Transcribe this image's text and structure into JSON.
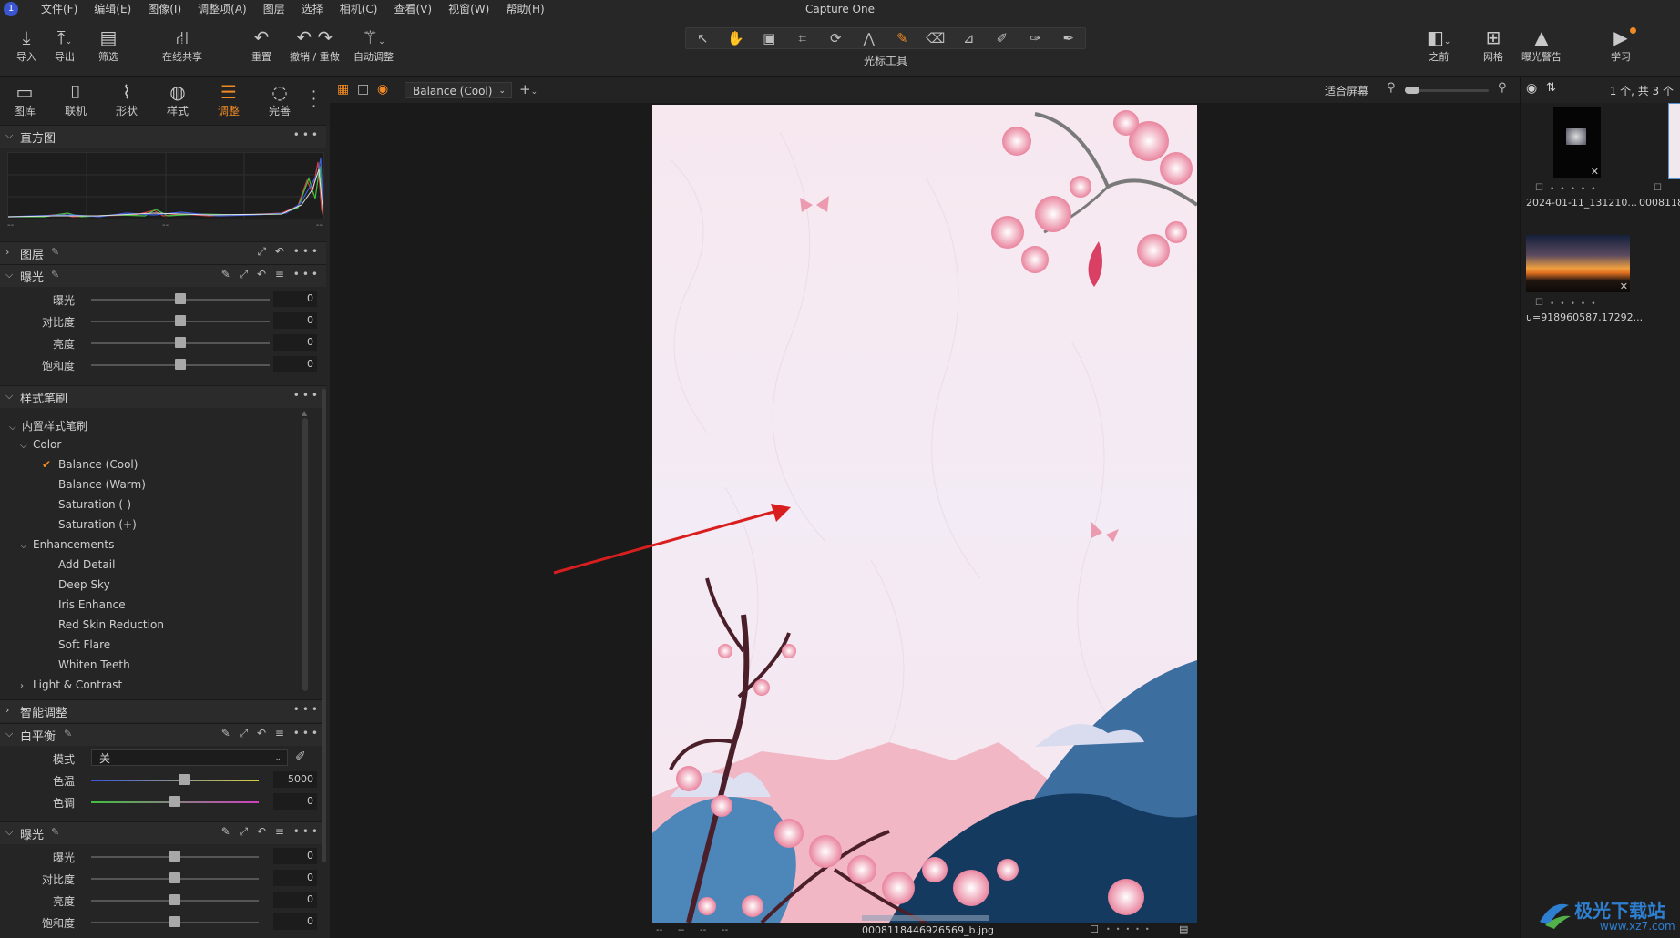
{
  "app": {
    "title": "Capture One"
  },
  "menu": [
    "文件(F)",
    "编辑(E)",
    "图像(I)",
    "调整项(A)",
    "图层",
    "选择",
    "相机(C)",
    "查看(V)",
    "视窗(W)",
    "帮助(H)"
  ],
  "toolbar": {
    "import": "导入",
    "export": "导出",
    "filter": "筛选",
    "share": "在线共享",
    "reset": "重置",
    "undo_redo": "撤销 / 重做",
    "auto_adjust": "自动调整",
    "cursor_tools": "光标工具",
    "before": "之前",
    "grid": "网格",
    "exposure_warning": "曝光警告",
    "learn": "学习"
  },
  "tool_tabs": [
    {
      "label": "图库",
      "icon": "folder-icon"
    },
    {
      "label": "联机",
      "icon": "camera-icon"
    },
    {
      "label": "形状",
      "icon": "shape-icon"
    },
    {
      "label": "样式",
      "icon": "style-icon"
    },
    {
      "label": "调整",
      "icon": "sliders-icon",
      "active": true
    },
    {
      "label": "完善",
      "icon": "circle-icon"
    }
  ],
  "histogram": {
    "title": "直方图",
    "ticks": [
      "--",
      "--",
      "--"
    ]
  },
  "layers": {
    "title": "图层"
  },
  "exposure1": {
    "title": "曝光",
    "rows": [
      {
        "label": "曝光",
        "value": "0",
        "pos": 0.5
      },
      {
        "label": "对比度",
        "value": "0",
        "pos": 0.5
      },
      {
        "label": "亮度",
        "value": "0",
        "pos": 0.5
      },
      {
        "label": "饱和度",
        "value": "0",
        "pos": 0.5
      }
    ]
  },
  "style_brush": {
    "title": "样式笔刷",
    "root": "内置样式笔刷",
    "color_group": "Color",
    "color_items": [
      "Balance (Cool)",
      "Balance (Warm)",
      "Saturation (-)",
      "Saturation (+)"
    ],
    "enh_group": "Enhancements",
    "enh_items": [
      "Add Detail",
      "Deep Sky",
      "Iris Enhance",
      "Red Skin Reduction",
      "Soft Flare",
      "Whiten Teeth"
    ],
    "light_group": "Light & Contrast"
  },
  "smart_adjust": {
    "title": "智能调整"
  },
  "white_balance": {
    "title": "白平衡",
    "mode_label": "模式",
    "mode_value": "关",
    "temp_label": "色温",
    "temp_value": "5000",
    "tint_label": "色调",
    "tint_value": "0"
  },
  "exposure2": {
    "title": "曝光",
    "rows": [
      {
        "label": "曝光",
        "value": "0",
        "pos": 0.5
      },
      {
        "label": "对比度",
        "value": "0",
        "pos": 0.5
      },
      {
        "label": "亮度",
        "value": "0",
        "pos": 0.5
      },
      {
        "label": "饱和度",
        "value": "0",
        "pos": 0.5
      }
    ]
  },
  "viewer": {
    "style_select": "Balance (Cool)",
    "fit_label": "适合屏幕",
    "footer_left": [
      "--",
      "--",
      "--",
      "--"
    ],
    "filename": "0008118446926569_b.jpg"
  },
  "browser": {
    "count": "1 个, 共 3 个",
    "thumbs": [
      {
        "caption": "2024-01-11_131210..."
      },
      {
        "caption": "0008118"
      },
      {
        "caption": "u=918960587,17292..."
      }
    ]
  },
  "watermark": {
    "text": "极光下载站",
    "url": "www.xz7.com"
  },
  "colors": {
    "accent": "#f08a24",
    "panel": "#252525",
    "viewer": "#1a1a1a"
  }
}
